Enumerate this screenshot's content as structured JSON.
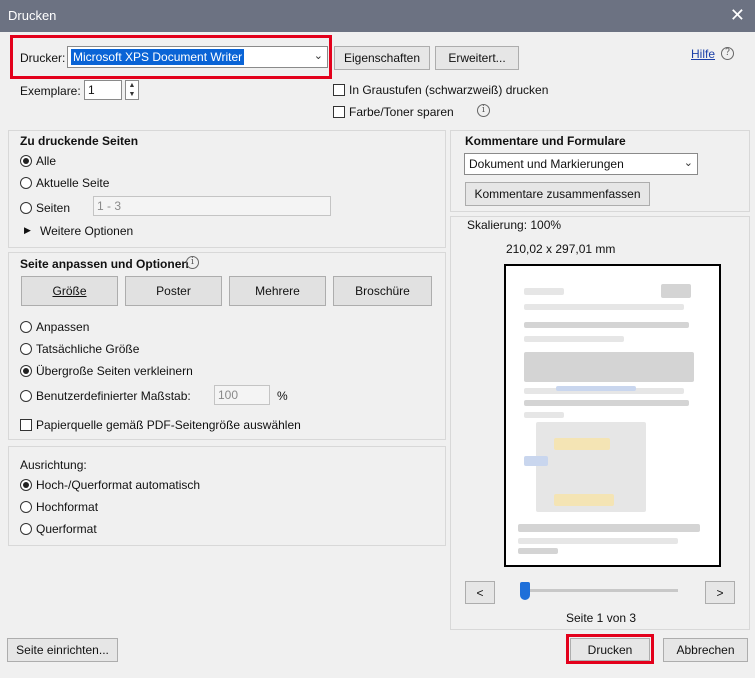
{
  "window": {
    "title": "Drucken",
    "close_glyph": "✕"
  },
  "printer": {
    "label": "Drucker:",
    "selected": "Microsoft XPS Document Writer",
    "properties_button": "Eigenschaften",
    "advanced_button": "Erweitert...",
    "help_link": "Hilfe",
    "copies_label": "Exemplare:",
    "copies_value": "1",
    "grayscale_label": "In Graustufen (schwarzweiß) drucken",
    "save_ink_label": "Farbe/Toner sparen"
  },
  "pages": {
    "title": "Zu druckende Seiten",
    "all": "Alle",
    "current": "Aktuelle Seite",
    "pages": "Seiten",
    "range": "1 - 3",
    "more": "Weitere Optionen"
  },
  "sizing": {
    "title": "Seite anpassen und Optionen",
    "tabs": [
      "Größe",
      "Poster",
      "Mehrere",
      "Broschüre"
    ],
    "fit": "Anpassen",
    "actual": "Tatsächliche Größe",
    "shrink": "Übergroße Seiten verkleinern",
    "custom": "Benutzerdefinierter Maßstab:",
    "custom_value": "100",
    "percent": "%",
    "paper_source": "Papierquelle gemäß PDF-Seitengröße auswählen"
  },
  "orientation": {
    "title": "Ausrichtung:",
    "auto": "Hoch-/Querformat automatisch",
    "portrait": "Hochformat",
    "landscape": "Querformat"
  },
  "comments": {
    "title": "Kommentare und Formulare",
    "selected": "Dokument und Markierungen",
    "summarize_button": "Kommentare zusammenfassen"
  },
  "preview": {
    "scaling": "Skalierung: 100%",
    "size": "210,02 x 297,01 mm",
    "prev": "<",
    "next": ">",
    "page_info": "Seite 1 von 3",
    "slider_position": 0.0
  },
  "footer": {
    "page_setup": "Seite einrichten...",
    "print": "Drucken",
    "cancel": "Abbrechen"
  },
  "colors": {
    "titlebar": "#6c7282",
    "highlight_frame": "#e3001b",
    "selection": "#0a64d6",
    "slider_thumb": "#1e6fd9"
  }
}
